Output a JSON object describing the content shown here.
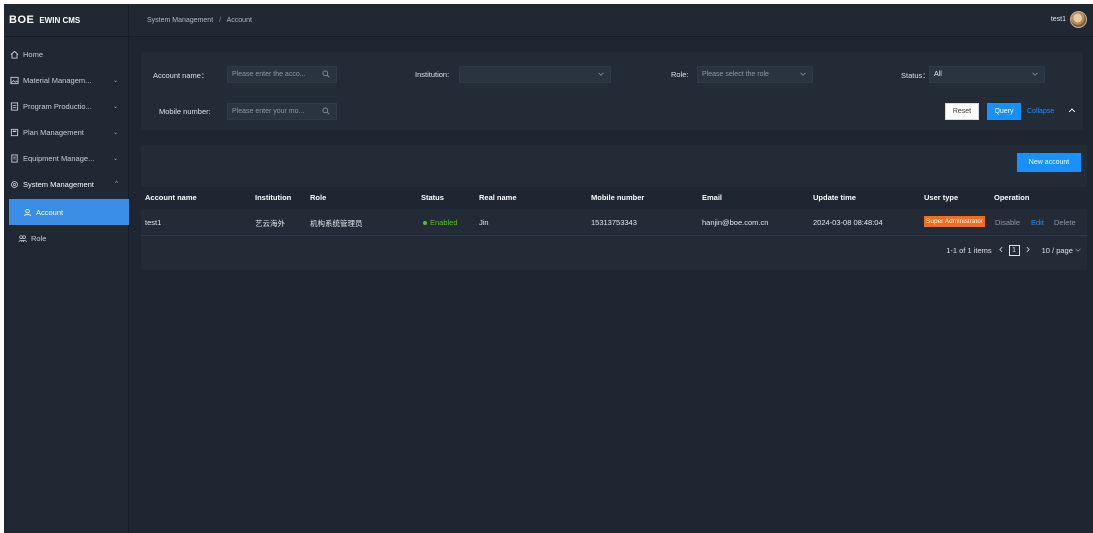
{
  "brand": {
    "logo": "BOE",
    "app_name": "EWIN CMS"
  },
  "sidebar": {
    "items": [
      {
        "label": "Home",
        "icon": "home-icon",
        "chevron": ""
      },
      {
        "label": "Material Managem...",
        "icon": "image-icon",
        "chevron": "⌄"
      },
      {
        "label": "Program Productio...",
        "icon": "document-icon",
        "chevron": "⌄"
      },
      {
        "label": "Plan Management",
        "icon": "calendar-icon",
        "chevron": "⌄"
      },
      {
        "label": "Equipment Manage...",
        "icon": "device-icon",
        "chevron": "⌄"
      },
      {
        "label": "System Management",
        "icon": "gear-icon",
        "chevron": "^"
      },
      {
        "label": "Account",
        "icon": "user-icon",
        "chevron": ""
      },
      {
        "label": "Role",
        "icon": "group-icon",
        "chevron": ""
      }
    ]
  },
  "header": {
    "breadcrumb": [
      "System Management",
      "Account"
    ],
    "breadcrumb_sep": "/",
    "user_name": "test1"
  },
  "filters": {
    "account_name_label": "Account name：",
    "account_name_placeholder": "Please enter the acco...",
    "institution_label": "Institution:",
    "institution_value": "",
    "role_label": "Role:",
    "role_placeholder": "Please select the role",
    "status_label": "Status：",
    "status_value": "All",
    "mobile_label": "Mobile number:",
    "mobile_placeholder": "Please enter your mo...",
    "reset_label": "Reset",
    "query_label": "Query",
    "collapse_label": "Collapse"
  },
  "table": {
    "new_account_label": "New account",
    "columns": [
      "Account name",
      "Institution",
      "Role",
      "Status",
      "Real name",
      "Mobile number",
      "Email",
      "Update time",
      "User type",
      "Operation"
    ],
    "rows": [
      {
        "account_name": "test1",
        "institution": "艺云海外",
        "role": "机构系统管理员",
        "status": "Enabled",
        "real_name": "Jin",
        "mobile": "15313753343",
        "email": "hanjin@boe.com.cn",
        "update_time": "2024-03-08 08:48:04",
        "user_type": "Super Administrator",
        "op_disable": "Disable",
        "op_edit": "Edit",
        "op_delete": "Delete"
      }
    ],
    "pagination": {
      "summary": "1-1 of 1 items",
      "current_page": "1",
      "page_size": "10 / page"
    }
  },
  "colors": {
    "accent": "#1890ff",
    "active_nav": "#3a8ee6",
    "status_enabled": "#52c41a",
    "badge": "#f56c1e",
    "background": "#1e2631"
  }
}
